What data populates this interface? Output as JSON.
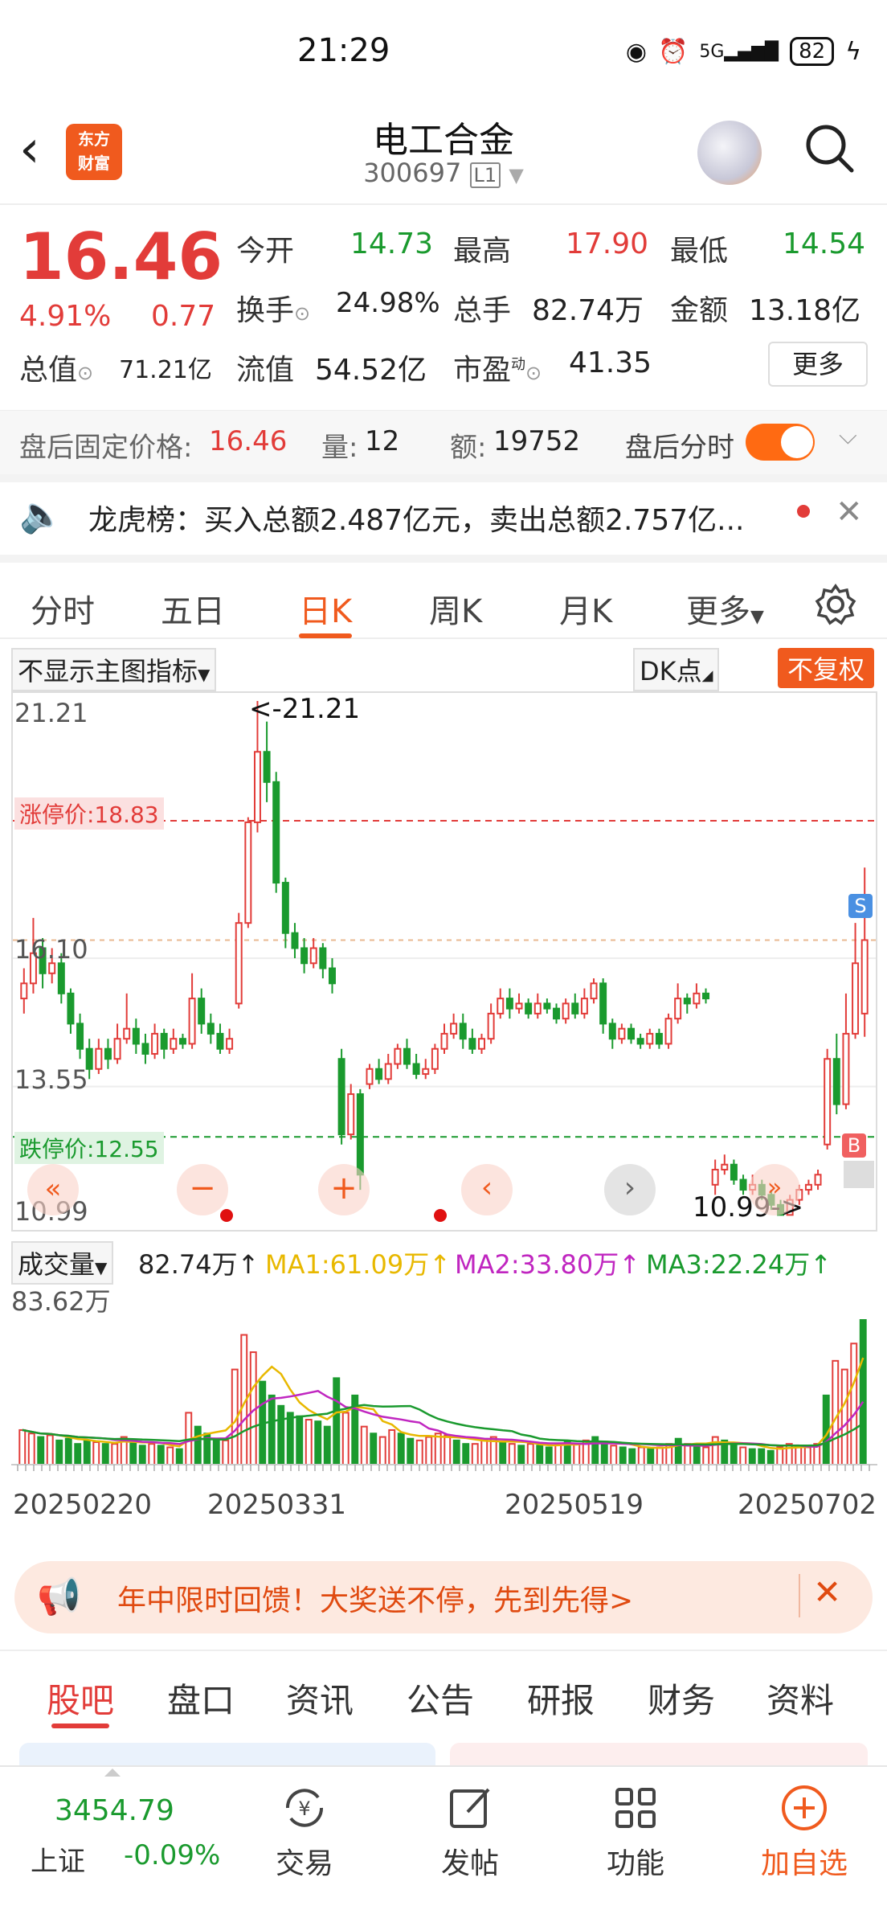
{
  "status_bar": {
    "time": "21:29",
    "battery": "82",
    "network": "5G"
  },
  "header": {
    "name": "电工合金",
    "code": "300697",
    "level": "L1",
    "logo_line1": "东方",
    "logo_line2": "财富"
  },
  "quote": {
    "price": "16.46",
    "change_pct": "4.91%",
    "change": "0.77",
    "open_label": "今开",
    "open": "14.73",
    "high_label": "最高",
    "high": "17.90",
    "low_label": "最低",
    "low": "14.54",
    "turnover_label": "换手",
    "turnover": "24.98%",
    "volume_label": "总手",
    "volume": "82.74万",
    "amount_label": "金额",
    "amount": "13.18亿",
    "mktcap_label": "总值",
    "mktcap": "71.21亿",
    "float_label": "流值",
    "float": "54.52亿",
    "pe_label": "市盈",
    "pe_sup": "动",
    "pe": "41.35",
    "more": "更多"
  },
  "after_hours": {
    "price_label": "盘后固定价格:",
    "price": "16.46",
    "vol_label": "量:",
    "vol": "12",
    "amt_label": "额:",
    "amt": "19752",
    "timeshare_label": "盘后分时"
  },
  "dragon": {
    "text": "龙虎榜：买入总额2.487亿元，卖出总额2.757亿..."
  },
  "tabs": [
    "分时",
    "五日",
    "日K",
    "周K",
    "月K",
    "更多"
  ],
  "chart": {
    "indicator_select": "不显示主图指标",
    "dk_label": "DK点",
    "adjust_label": "不复权",
    "y_labels": [
      "21.21",
      "16.10",
      "13.55",
      "10.99"
    ],
    "limit_up": "涨停价:18.83",
    "limit_down": "跌停价:12.55",
    "max_marker": "<-21.21",
    "min_marker": "10.99->",
    "s_marker": "S",
    "b_marker": "B"
  },
  "volume": {
    "select": "成交量",
    "vol": "82.74万",
    "ma1": "MA1:61.09万",
    "ma2": "MA2:33.80万",
    "ma3": "MA3:22.24万",
    "max_label": "83.62万"
  },
  "dates": [
    "20250220",
    "20250331",
    "20250519",
    "20250702"
  ],
  "banner": {
    "text": "年中限时回馈！大奖送不停，先到先得>"
  },
  "subtabs": [
    "股吧",
    "盘口",
    "资讯",
    "公告",
    "研报",
    "财务",
    "资料"
  ],
  "bottom": {
    "index_value": "3454.79",
    "index_name": "上证",
    "index_change": "-0.09%",
    "trade": "交易",
    "post": "发帖",
    "function": "功能",
    "add": "加自选"
  },
  "colors": {
    "up": "#e23c39",
    "down": "#1a9a2e",
    "accent": "#f05a1e"
  },
  "chart_data": {
    "type": "candlestick",
    "y_range": [
      10.99,
      21.21
    ],
    "price_levels": {
      "limit_up": 18.83,
      "limit_down": 12.55,
      "high": 21.21,
      "low": 10.99
    },
    "x_date_labels": [
      "20250220",
      "20250331",
      "20250519",
      "20250702"
    ]
  }
}
